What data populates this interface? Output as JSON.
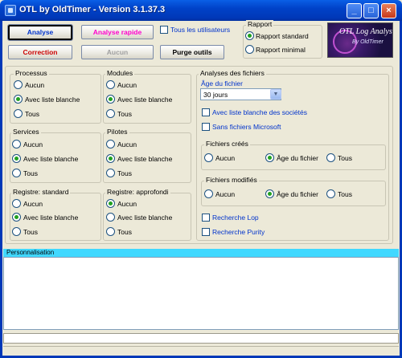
{
  "window": {
    "title": "OTL by OldTimer - Version 3.1.37.3",
    "controls": [
      "minimize-icon",
      "maximize-icon",
      "close-icon"
    ]
  },
  "toolbar": {
    "analyse": "Analyse",
    "analyse_rapide": "Analyse rapide",
    "correction": "Correction",
    "aucun": "Aucun",
    "purge": "Purge outils",
    "tous_utilisateurs": "Tous les utilisateurs",
    "colors": {
      "analyse": "#0033cc",
      "analyse_rapide": "#ff00cc",
      "correction": "#cc0000"
    }
  },
  "rapport": {
    "legend": "Rapport",
    "standard": "Rapport standard",
    "minimal": "Rapport minimal",
    "selected": "standard"
  },
  "logo": {
    "title": "OTL Log Analysis",
    "subtitle": "By OldTimer"
  },
  "scan_groups": {
    "processus": {
      "legend": "Processus",
      "options": [
        "Aucun",
        "Avec liste blanche",
        "Tous"
      ],
      "selected": 1
    },
    "modules": {
      "legend": "Modules",
      "options": [
        "Aucun",
        "Avec liste blanche",
        "Tous"
      ],
      "selected": 1
    },
    "services": {
      "legend": "Services",
      "options": [
        "Aucun",
        "Avec liste blanche",
        "Tous"
      ],
      "selected": 1
    },
    "pilotes": {
      "legend": "Pilotes",
      "options": [
        "Aucun",
        "Avec liste blanche",
        "Tous"
      ],
      "selected": 1
    },
    "registre_standard": {
      "legend": "Registre: standard",
      "options": [
        "Aucun",
        "Avec liste blanche",
        "Tous"
      ],
      "selected": 1
    },
    "registre_approfondi": {
      "legend": "Registre: approfondi",
      "options": [
        "Aucun",
        "Avec liste blanche",
        "Tous"
      ],
      "selected": 0
    }
  },
  "analyses": {
    "legend": "Analyses des fichiers",
    "age_label": "Âge du fichier",
    "age_value": "30 jours",
    "liste_blanche_societes": "Avec liste blanche des sociétés",
    "sans_microsoft": "Sans fichiers Microsoft",
    "crees": {
      "legend": "Fichiers créés",
      "options": [
        "Aucun",
        "Âge du fichier",
        "Tous"
      ],
      "selected": 1
    },
    "modifies": {
      "legend": "Fichiers modifiés",
      "options": [
        "Aucun",
        "Âge du fichier",
        "Tous"
      ],
      "selected": 1
    },
    "recherche_lop": "Recherche Lop",
    "recherche_purity": "Recherche Purity"
  },
  "personnalisation": {
    "label": "Personnalisation",
    "header_color": "#40d8ff"
  }
}
